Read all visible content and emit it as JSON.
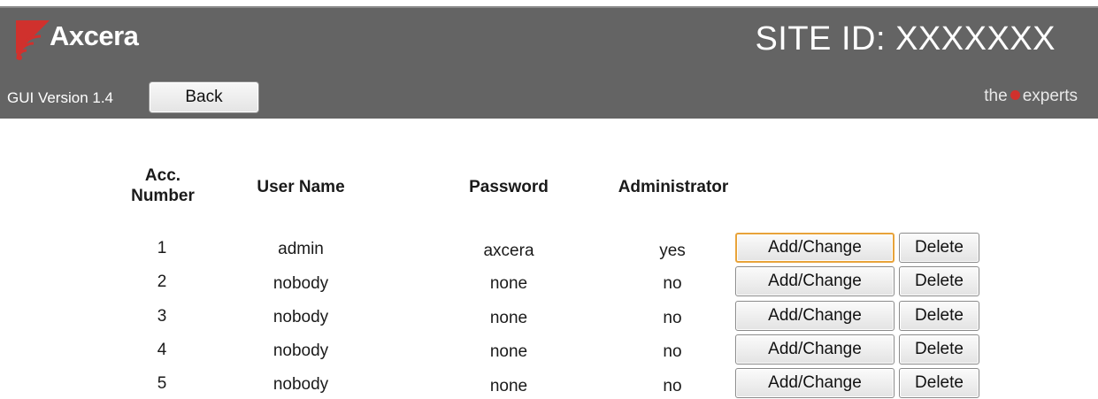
{
  "header": {
    "logo_text": "Axcera",
    "site_id": "SITE ID: XXXXXXX",
    "gui_version": "GUI Version 1.4",
    "back_label": "Back",
    "tagline_left": "the",
    "tagline_right": "experts",
    "accent_color": "#d0312d",
    "background_color": "#646464"
  },
  "table": {
    "headers": {
      "acc_line1": "Acc.",
      "acc_line2": "Number",
      "user": "User Name",
      "password": "Password",
      "admin": "Administrator"
    },
    "rows": [
      {
        "acc": "1",
        "user": "admin",
        "password": "axcera",
        "admin": "yes",
        "add_label": "Add/Change",
        "delete_label": "Delete"
      },
      {
        "acc": "2",
        "user": "nobody",
        "password": "none",
        "admin": "no",
        "add_label": "Add/Change",
        "delete_label": "Delete"
      },
      {
        "acc": "3",
        "user": "nobody",
        "password": "none",
        "admin": "no",
        "add_label": "Add/Change",
        "delete_label": "Delete"
      },
      {
        "acc": "4",
        "user": "nobody",
        "password": "none",
        "admin": "no",
        "add_label": "Add/Change",
        "delete_label": "Delete"
      },
      {
        "acc": "5",
        "user": "nobody",
        "password": "none",
        "admin": "no",
        "add_label": "Add/Change",
        "delete_label": "Delete"
      }
    ]
  }
}
